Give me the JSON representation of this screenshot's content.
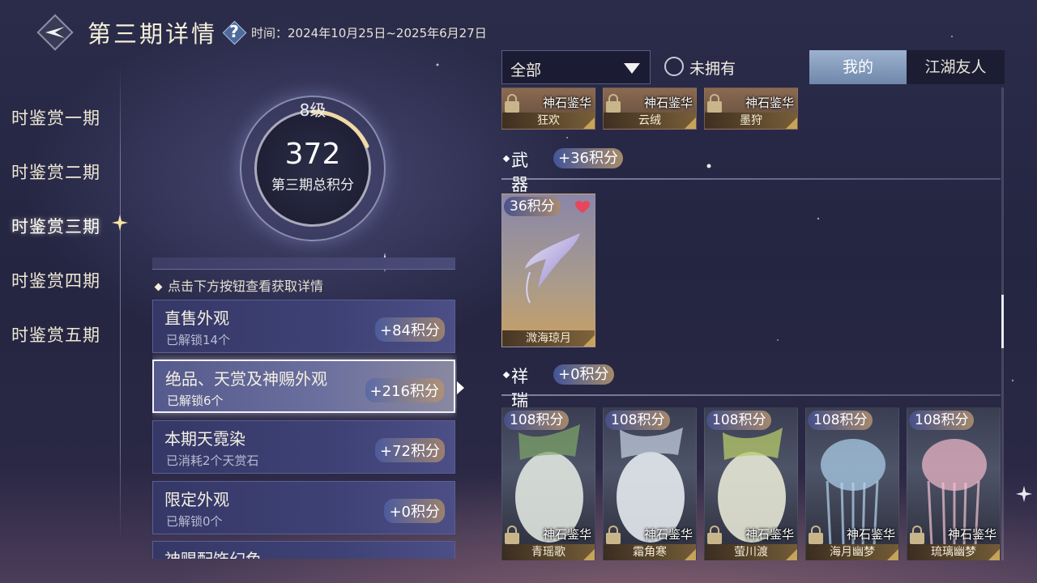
{
  "header": {
    "title": "第三期详情",
    "help_icon": "question-icon",
    "period_label": "时间：2024年10月25日~2025年6月27日"
  },
  "nav": {
    "items": [
      "时鉴赏一期",
      "时鉴赏二期",
      "时鉴赏三期",
      "时鉴赏四期",
      "时鉴赏五期"
    ],
    "active_index": 2
  },
  "score": {
    "level": "8级",
    "total": "372",
    "label": "第三期总积分",
    "progress_fraction": 0.18
  },
  "tip": "点击下方按钮查看获取详情",
  "categories": [
    {
      "title": "直售外观",
      "sub": "已解锁14个",
      "points": "+84积分"
    },
    {
      "title": "绝品、天赏及神赐外观",
      "sub": "已解锁6个",
      "points": "+216积分",
      "selected": true
    },
    {
      "title": "本期天霓染",
      "sub": "已消耗2个天赏石",
      "points": "+72积分"
    },
    {
      "title": "限定外观",
      "sub": "已解锁0个",
      "points": "+0积分"
    },
    {
      "title": "神赐配饰幻色",
      "sub": "",
      "points": ""
    }
  ],
  "filter": {
    "selected": "全部",
    "not_owned_label": "未拥有"
  },
  "tabs": {
    "mine": "我的",
    "friends": "江湖友人",
    "active": "mine"
  },
  "top_items": [
    {
      "source": "神石鉴华",
      "name": "狂欢"
    },
    {
      "source": "神石鉴华",
      "name": "云绒"
    },
    {
      "source": "神石鉴华",
      "name": "墨狩"
    }
  ],
  "sections": {
    "weapon": {
      "label": "武器",
      "points": "+36积分",
      "items": [
        {
          "points": "36积分",
          "name": "溦海琼月",
          "favorite": true
        }
      ]
    },
    "auspicious": {
      "label": "祥瑞",
      "points": "+0积分",
      "items": [
        {
          "points": "108积分",
          "source": "神石鉴华",
          "name": "青瑶歌"
        },
        {
          "points": "108积分",
          "source": "神石鉴华",
          "name": "霜角寒"
        },
        {
          "points": "108积分",
          "source": "神石鉴华",
          "name": "萤川渡"
        },
        {
          "points": "108积分",
          "source": "神石鉴华",
          "name": "海月幽梦"
        },
        {
          "points": "108积分",
          "source": "神石鉴华",
          "name": "琉璃幽梦"
        }
      ]
    }
  },
  "colors": {
    "accent_gold": "#e8c27a",
    "tab_active": "#8aa0c0",
    "background": "#262741"
  }
}
